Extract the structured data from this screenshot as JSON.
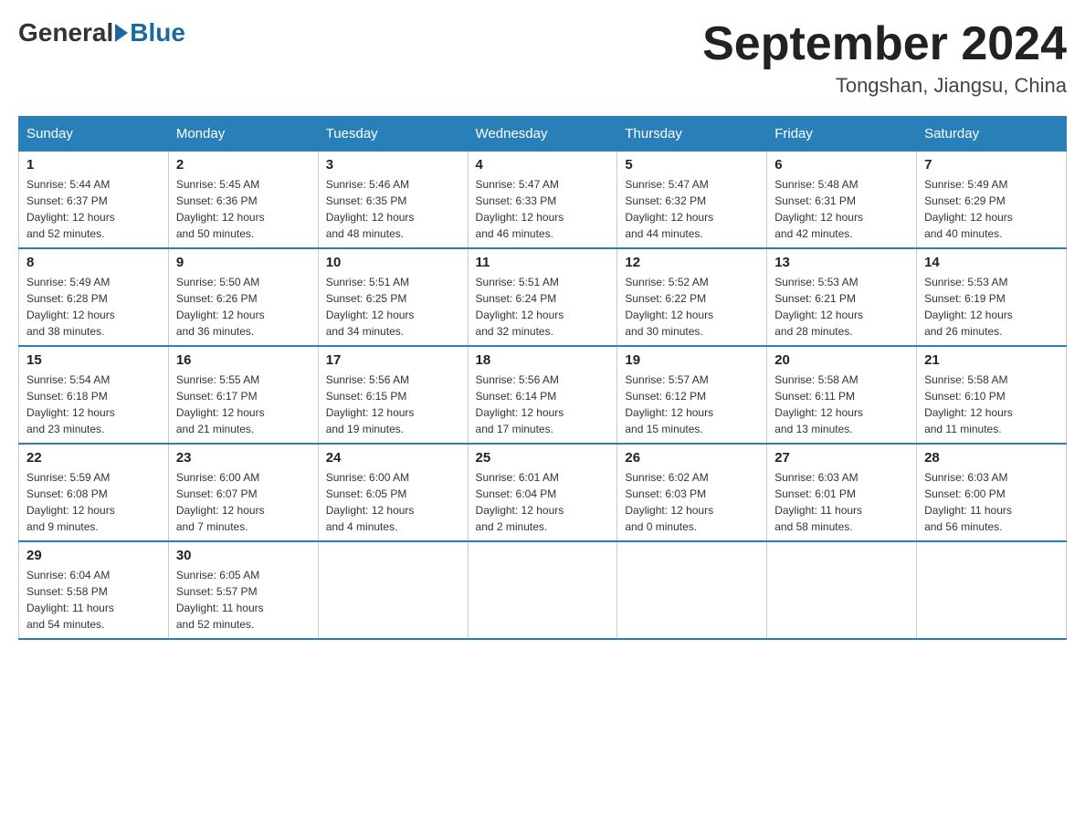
{
  "header": {
    "logo_general": "General",
    "logo_blue": "Blue",
    "month_title": "September 2024",
    "location": "Tongshan, Jiangsu, China"
  },
  "weekdays": [
    "Sunday",
    "Monday",
    "Tuesday",
    "Wednesday",
    "Thursday",
    "Friday",
    "Saturday"
  ],
  "weeks": [
    [
      {
        "day": "1",
        "sunrise": "5:44 AM",
        "sunset": "6:37 PM",
        "daylight": "12 hours and 52 minutes."
      },
      {
        "day": "2",
        "sunrise": "5:45 AM",
        "sunset": "6:36 PM",
        "daylight": "12 hours and 50 minutes."
      },
      {
        "day": "3",
        "sunrise": "5:46 AM",
        "sunset": "6:35 PM",
        "daylight": "12 hours and 48 minutes."
      },
      {
        "day": "4",
        "sunrise": "5:47 AM",
        "sunset": "6:33 PM",
        "daylight": "12 hours and 46 minutes."
      },
      {
        "day": "5",
        "sunrise": "5:47 AM",
        "sunset": "6:32 PM",
        "daylight": "12 hours and 44 minutes."
      },
      {
        "day": "6",
        "sunrise": "5:48 AM",
        "sunset": "6:31 PM",
        "daylight": "12 hours and 42 minutes."
      },
      {
        "day": "7",
        "sunrise": "5:49 AM",
        "sunset": "6:29 PM",
        "daylight": "12 hours and 40 minutes."
      }
    ],
    [
      {
        "day": "8",
        "sunrise": "5:49 AM",
        "sunset": "6:28 PM",
        "daylight": "12 hours and 38 minutes."
      },
      {
        "day": "9",
        "sunrise": "5:50 AM",
        "sunset": "6:26 PM",
        "daylight": "12 hours and 36 minutes."
      },
      {
        "day": "10",
        "sunrise": "5:51 AM",
        "sunset": "6:25 PM",
        "daylight": "12 hours and 34 minutes."
      },
      {
        "day": "11",
        "sunrise": "5:51 AM",
        "sunset": "6:24 PM",
        "daylight": "12 hours and 32 minutes."
      },
      {
        "day": "12",
        "sunrise": "5:52 AM",
        "sunset": "6:22 PM",
        "daylight": "12 hours and 30 minutes."
      },
      {
        "day": "13",
        "sunrise": "5:53 AM",
        "sunset": "6:21 PM",
        "daylight": "12 hours and 28 minutes."
      },
      {
        "day": "14",
        "sunrise": "5:53 AM",
        "sunset": "6:19 PM",
        "daylight": "12 hours and 26 minutes."
      }
    ],
    [
      {
        "day": "15",
        "sunrise": "5:54 AM",
        "sunset": "6:18 PM",
        "daylight": "12 hours and 23 minutes."
      },
      {
        "day": "16",
        "sunrise": "5:55 AM",
        "sunset": "6:17 PM",
        "daylight": "12 hours and 21 minutes."
      },
      {
        "day": "17",
        "sunrise": "5:56 AM",
        "sunset": "6:15 PM",
        "daylight": "12 hours and 19 minutes."
      },
      {
        "day": "18",
        "sunrise": "5:56 AM",
        "sunset": "6:14 PM",
        "daylight": "12 hours and 17 minutes."
      },
      {
        "day": "19",
        "sunrise": "5:57 AM",
        "sunset": "6:12 PM",
        "daylight": "12 hours and 15 minutes."
      },
      {
        "day": "20",
        "sunrise": "5:58 AM",
        "sunset": "6:11 PM",
        "daylight": "12 hours and 13 minutes."
      },
      {
        "day": "21",
        "sunrise": "5:58 AM",
        "sunset": "6:10 PM",
        "daylight": "12 hours and 11 minutes."
      }
    ],
    [
      {
        "day": "22",
        "sunrise": "5:59 AM",
        "sunset": "6:08 PM",
        "daylight": "12 hours and 9 minutes."
      },
      {
        "day": "23",
        "sunrise": "6:00 AM",
        "sunset": "6:07 PM",
        "daylight": "12 hours and 7 minutes."
      },
      {
        "day": "24",
        "sunrise": "6:00 AM",
        "sunset": "6:05 PM",
        "daylight": "12 hours and 4 minutes."
      },
      {
        "day": "25",
        "sunrise": "6:01 AM",
        "sunset": "6:04 PM",
        "daylight": "12 hours and 2 minutes."
      },
      {
        "day": "26",
        "sunrise": "6:02 AM",
        "sunset": "6:03 PM",
        "daylight": "12 hours and 0 minutes."
      },
      {
        "day": "27",
        "sunrise": "6:03 AM",
        "sunset": "6:01 PM",
        "daylight": "11 hours and 58 minutes."
      },
      {
        "day": "28",
        "sunrise": "6:03 AM",
        "sunset": "6:00 PM",
        "daylight": "11 hours and 56 minutes."
      }
    ],
    [
      {
        "day": "29",
        "sunrise": "6:04 AM",
        "sunset": "5:58 PM",
        "daylight": "11 hours and 54 minutes."
      },
      {
        "day": "30",
        "sunrise": "6:05 AM",
        "sunset": "5:57 PM",
        "daylight": "11 hours and 52 minutes."
      },
      null,
      null,
      null,
      null,
      null
    ]
  ],
  "labels": {
    "sunrise": "Sunrise:",
    "sunset": "Sunset:",
    "daylight": "Daylight:"
  }
}
